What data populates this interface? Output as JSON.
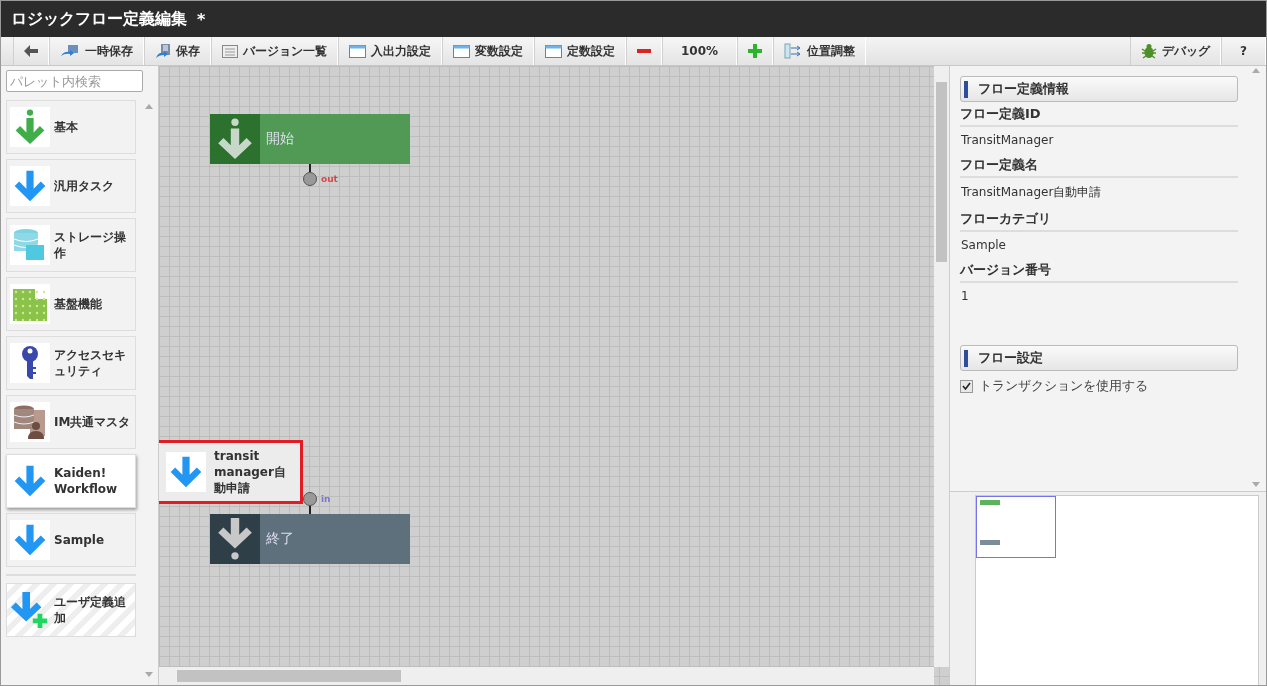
{
  "window": {
    "title": "ロジックフロー定義編集",
    "modified_mark": "*"
  },
  "toolbar": {
    "left": [
      {
        "kind": "back"
      },
      {
        "kind": "temp-save",
        "label": "一時保存"
      },
      {
        "kind": "save",
        "label": "保存"
      },
      {
        "kind": "list",
        "label": "バージョン一覧"
      },
      {
        "kind": "window",
        "label": "入出力設定"
      },
      {
        "kind": "window",
        "label": "変数設定"
      },
      {
        "kind": "window",
        "label": "定数設定"
      },
      {
        "kind": "minus"
      },
      {
        "kind": "text",
        "label": "100%"
      },
      {
        "kind": "plus"
      },
      {
        "kind": "align",
        "label": "位置調整"
      }
    ],
    "right": [
      {
        "kind": "bug",
        "label": "デバッグ"
      },
      {
        "kind": "text",
        "label": "?"
      }
    ]
  },
  "palette": {
    "search": {
      "placeholder": "パレット内検索"
    },
    "items": [
      {
        "label": "基本",
        "kind": "info-arrow",
        "selected": false
      },
      {
        "label": "汎用タスク",
        "kind": "arrow",
        "selected": false
      },
      {
        "label": "ストレージ操作",
        "kind": "storage",
        "selected": false
      },
      {
        "label": "基盤機能",
        "kind": "grid",
        "selected": false
      },
      {
        "label": "アクセスセキュリティ",
        "kind": "key",
        "selected": false
      },
      {
        "label": "IM共通マスタ",
        "kind": "db-person",
        "selected": false
      },
      {
        "label": "Kaiden! Workflow",
        "kind": "arrow",
        "selected": true
      },
      {
        "label": "Sample",
        "kind": "arrow",
        "selected": false
      }
    ],
    "add_item": {
      "label": "ユーザ定義追加"
    }
  },
  "canvas": {
    "nodes": [
      {
        "kind": "start",
        "label": "開始",
        "port": "out"
      },
      {
        "kind": "end",
        "label": "終了",
        "port": "in"
      }
    ],
    "dragged_item": {
      "label": "transit manager自動申請"
    }
  },
  "properties": {
    "sections": [
      {
        "title": "フロー定義情報",
        "fields": [
          {
            "label": "フロー定義ID",
            "value": "TransitManager"
          },
          {
            "label": "フロー定義名",
            "value": "TransitManager自動申請"
          },
          {
            "label": "フローカテゴリ",
            "value": "Sample"
          },
          {
            "label": "バージョン番号",
            "value": "1"
          }
        ]
      },
      {
        "title": "フロー設定",
        "checkboxes": [
          {
            "label": "トランザクションを使用する",
            "checked": true
          }
        ]
      }
    ]
  }
}
